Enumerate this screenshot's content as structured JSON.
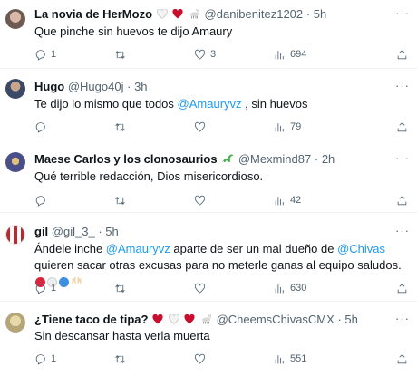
{
  "tweets": [
    {
      "name": "La novia de HerMozo",
      "handle": "@danibenitez1202",
      "time": "5h",
      "text": "Que pinche sin huevos te dijo Amaury",
      "replies": "1",
      "likes": "3",
      "views": "694",
      "avatar_color": "#6d5a52"
    },
    {
      "name": "Hugo",
      "handle": "@Hugo40j",
      "time": "3h",
      "text_before": "Te dijo lo mismo que todos ",
      "mention": "@Amauryvz",
      "text_after": " , sin huevos",
      "views": "79",
      "avatar_color": "#3a4a66"
    },
    {
      "name": "Maese Carlos y los clonosaurios",
      "handle": "@Mexmind87",
      "time": "2h",
      "text": "Qué terrible redacción, Dios misericordioso.",
      "views": "42",
      "avatar_color": "#4a4f8a"
    },
    {
      "name": "gil",
      "handle": "@gil_3_",
      "time": "5h",
      "text_1": "Ándele inche ",
      "mention_1": "@Amauryvz",
      "text_2": " aparte de ser un mal dueño de ",
      "mention_2": "@Chivas",
      "text_3": " quieren sacar otras excusas para no meterle ganas al equipo saludos.",
      "replies": "1",
      "views": "630",
      "avatar_color": "#c0262d"
    },
    {
      "name": "¿Tiene taco de tipa?",
      "handle": "@CheemsChivasCMX",
      "time": "5h",
      "text": "Sin descansar hasta verla muerta",
      "replies": "1",
      "views": "551",
      "avatar_color": "#b5a67a"
    }
  ],
  "sep": "·",
  "more": "···",
  "colors": {
    "accent": "#1d9bf0",
    "muted": "#536471",
    "heart": "#c8102e"
  }
}
